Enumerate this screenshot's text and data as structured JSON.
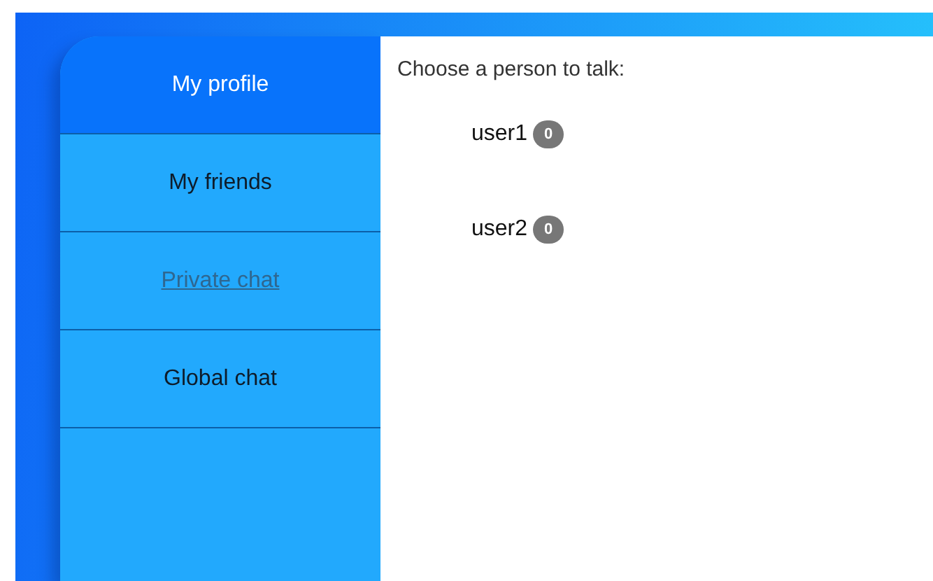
{
  "sidebar": {
    "items": [
      {
        "label": "My profile",
        "selected": true,
        "underlined": false
      },
      {
        "label": "My friends",
        "selected": false,
        "underlined": false
      },
      {
        "label": "Private chat",
        "selected": false,
        "underlined": true
      },
      {
        "label": "Global chat",
        "selected": false,
        "underlined": false
      }
    ]
  },
  "main": {
    "prompt": "Choose a person to talk:",
    "users": [
      {
        "name": "user1",
        "unread": "0"
      },
      {
        "name": "user2",
        "unread": "0"
      }
    ]
  }
}
